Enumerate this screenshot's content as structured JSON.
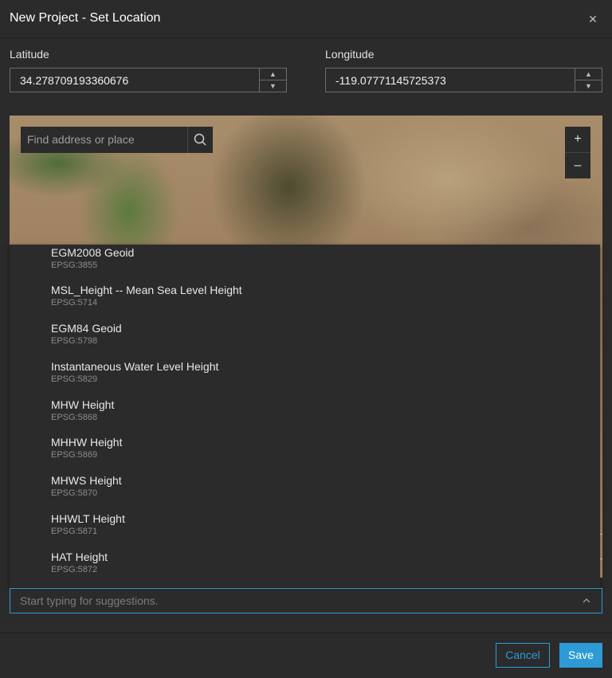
{
  "dialog": {
    "title": "New Project - Set Location",
    "close_glyph": "✕"
  },
  "latitude": {
    "label": "Latitude",
    "value": "34.278709193360676",
    "up": "▲",
    "down": "▼"
  },
  "longitude": {
    "label": "Longitude",
    "value": "-119.07771145725373",
    "up": "▲",
    "down": "▼"
  },
  "map": {
    "search_placeholder": "Find address or place",
    "zoom_in": "+",
    "zoom_out": "–"
  },
  "vertical_datum_options": [
    {
      "name": "EGM2008 Geoid",
      "code": "EPSG:3855"
    },
    {
      "name": "MSL_Height -- Mean Sea Level Height",
      "code": "EPSG:5714"
    },
    {
      "name": "EGM84 Geoid",
      "code": "EPSG:5798"
    },
    {
      "name": "Instantaneous Water Level Height",
      "code": "EPSG:5829"
    },
    {
      "name": "MHW Height",
      "code": "EPSG:5868"
    },
    {
      "name": "MHHW Height",
      "code": "EPSG:5869"
    },
    {
      "name": "MHWS Height",
      "code": "EPSG:5870"
    },
    {
      "name": "HHWLT Height",
      "code": "EPSG:5871"
    },
    {
      "name": "HAT Height",
      "code": "EPSG:5872"
    }
  ],
  "combo": {
    "placeholder": "Start typing for suggestions."
  },
  "footer": {
    "cancel_label": "Cancel",
    "save_label": "Save"
  },
  "colors": {
    "accent": "#2e9bd6",
    "background": "#2b2b2b"
  }
}
